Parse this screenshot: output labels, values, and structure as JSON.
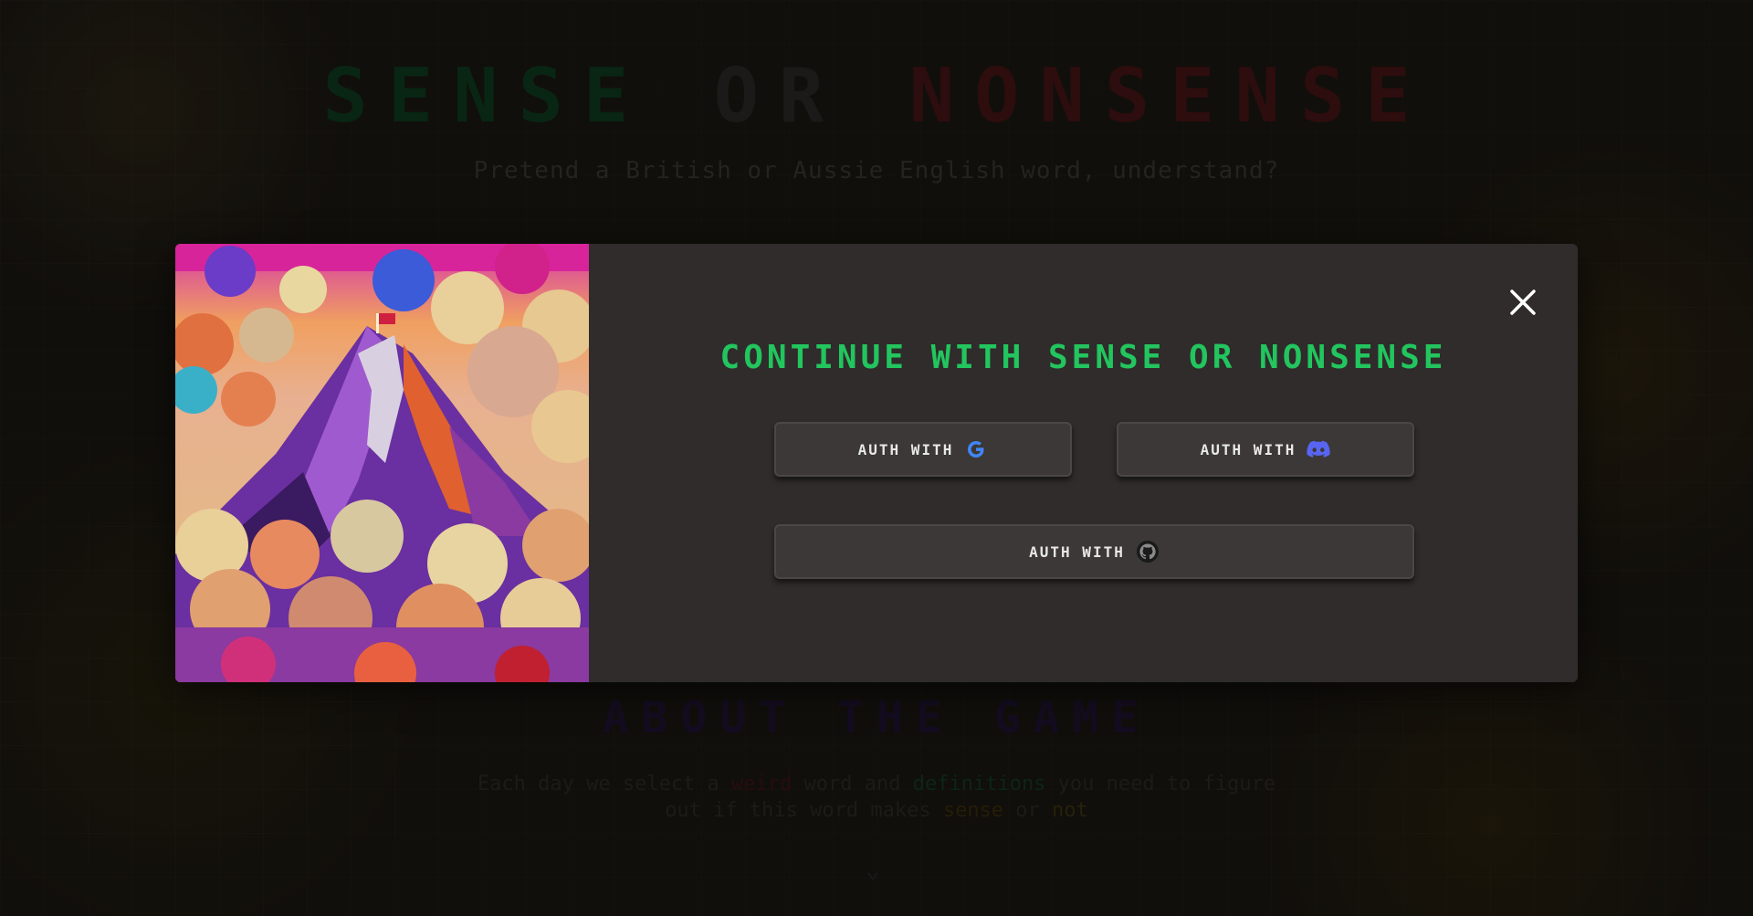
{
  "background": {
    "title_parts": [
      "SENSE",
      "OR",
      "NONSENSE"
    ],
    "subtitle": "Pretend a British or Aussie English word, understand?",
    "about_heading": "ABOUT THE GAME",
    "description_line1": {
      "pre": "Each day we select a ",
      "word1": "weird",
      "mid": " word and ",
      "word2": "definitions",
      "post": " you need to figure"
    },
    "description_line2": {
      "pre": "out if this word makes ",
      "word1": "sense",
      "mid": " or ",
      "word2": "not"
    },
    "chevron": "⌄"
  },
  "modal": {
    "heading": "CONTINUE WITH SENSE OR NONSENSE",
    "buttons": [
      {
        "label": "AUTH WITH",
        "provider": "google",
        "icon": "google-icon",
        "icon_color": "#4285F4"
      },
      {
        "label": "AUTH WITH",
        "provider": "discord",
        "icon": "discord-icon",
        "icon_color": "#5865F2"
      },
      {
        "label": "AUTH WITH",
        "provider": "github",
        "icon": "github-icon",
        "icon_color": "#222222"
      }
    ],
    "close_icon": "close-icon"
  },
  "colors": {
    "heading_green": "#22c55e",
    "modal_bg": "#2f2c2b",
    "button_bg": "#3b3837"
  }
}
